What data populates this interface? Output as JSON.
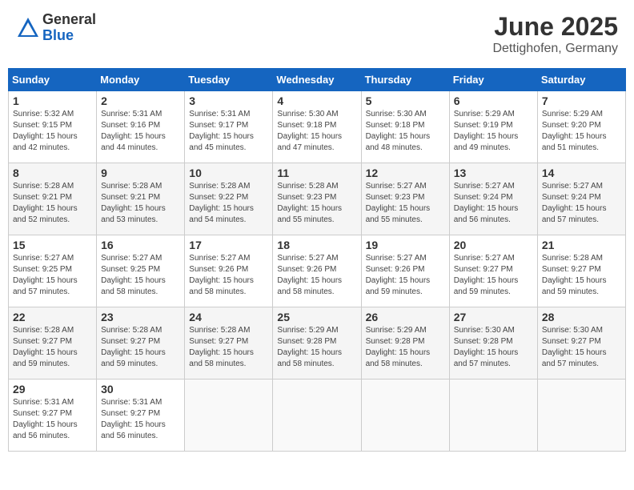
{
  "header": {
    "logo_general": "General",
    "logo_blue": "Blue",
    "month": "June 2025",
    "location": "Dettighofen, Germany"
  },
  "calendar": {
    "days_of_week": [
      "Sunday",
      "Monday",
      "Tuesday",
      "Wednesday",
      "Thursday",
      "Friday",
      "Saturday"
    ],
    "weeks": [
      [
        {
          "day": "",
          "info": ""
        },
        {
          "day": "2",
          "info": "Sunrise: 5:31 AM\nSunset: 9:16 PM\nDaylight: 15 hours\nand 44 minutes."
        },
        {
          "day": "3",
          "info": "Sunrise: 5:31 AM\nSunset: 9:17 PM\nDaylight: 15 hours\nand 45 minutes."
        },
        {
          "day": "4",
          "info": "Sunrise: 5:30 AM\nSunset: 9:18 PM\nDaylight: 15 hours\nand 47 minutes."
        },
        {
          "day": "5",
          "info": "Sunrise: 5:30 AM\nSunset: 9:18 PM\nDaylight: 15 hours\nand 48 minutes."
        },
        {
          "day": "6",
          "info": "Sunrise: 5:29 AM\nSunset: 9:19 PM\nDaylight: 15 hours\nand 49 minutes."
        },
        {
          "day": "7",
          "info": "Sunrise: 5:29 AM\nSunset: 9:20 PM\nDaylight: 15 hours\nand 51 minutes."
        }
      ],
      [
        {
          "day": "8",
          "info": "Sunrise: 5:28 AM\nSunset: 9:21 PM\nDaylight: 15 hours\nand 52 minutes."
        },
        {
          "day": "9",
          "info": "Sunrise: 5:28 AM\nSunset: 9:21 PM\nDaylight: 15 hours\nand 53 minutes."
        },
        {
          "day": "10",
          "info": "Sunrise: 5:28 AM\nSunset: 9:22 PM\nDaylight: 15 hours\nand 54 minutes."
        },
        {
          "day": "11",
          "info": "Sunrise: 5:28 AM\nSunset: 9:23 PM\nDaylight: 15 hours\nand 55 minutes."
        },
        {
          "day": "12",
          "info": "Sunrise: 5:27 AM\nSunset: 9:23 PM\nDaylight: 15 hours\nand 55 minutes."
        },
        {
          "day": "13",
          "info": "Sunrise: 5:27 AM\nSunset: 9:24 PM\nDaylight: 15 hours\nand 56 minutes."
        },
        {
          "day": "14",
          "info": "Sunrise: 5:27 AM\nSunset: 9:24 PM\nDaylight: 15 hours\nand 57 minutes."
        }
      ],
      [
        {
          "day": "15",
          "info": "Sunrise: 5:27 AM\nSunset: 9:25 PM\nDaylight: 15 hours\nand 57 minutes."
        },
        {
          "day": "16",
          "info": "Sunrise: 5:27 AM\nSunset: 9:25 PM\nDaylight: 15 hours\nand 58 minutes."
        },
        {
          "day": "17",
          "info": "Sunrise: 5:27 AM\nSunset: 9:26 PM\nDaylight: 15 hours\nand 58 minutes."
        },
        {
          "day": "18",
          "info": "Sunrise: 5:27 AM\nSunset: 9:26 PM\nDaylight: 15 hours\nand 58 minutes."
        },
        {
          "day": "19",
          "info": "Sunrise: 5:27 AM\nSunset: 9:26 PM\nDaylight: 15 hours\nand 59 minutes."
        },
        {
          "day": "20",
          "info": "Sunrise: 5:27 AM\nSunset: 9:27 PM\nDaylight: 15 hours\nand 59 minutes."
        },
        {
          "day": "21",
          "info": "Sunrise: 5:28 AM\nSunset: 9:27 PM\nDaylight: 15 hours\nand 59 minutes."
        }
      ],
      [
        {
          "day": "22",
          "info": "Sunrise: 5:28 AM\nSunset: 9:27 PM\nDaylight: 15 hours\nand 59 minutes."
        },
        {
          "day": "23",
          "info": "Sunrise: 5:28 AM\nSunset: 9:27 PM\nDaylight: 15 hours\nand 59 minutes."
        },
        {
          "day": "24",
          "info": "Sunrise: 5:28 AM\nSunset: 9:27 PM\nDaylight: 15 hours\nand 58 minutes."
        },
        {
          "day": "25",
          "info": "Sunrise: 5:29 AM\nSunset: 9:28 PM\nDaylight: 15 hours\nand 58 minutes."
        },
        {
          "day": "26",
          "info": "Sunrise: 5:29 AM\nSunset: 9:28 PM\nDaylight: 15 hours\nand 58 minutes."
        },
        {
          "day": "27",
          "info": "Sunrise: 5:30 AM\nSunset: 9:28 PM\nDaylight: 15 hours\nand 57 minutes."
        },
        {
          "day": "28",
          "info": "Sunrise: 5:30 AM\nSunset: 9:27 PM\nDaylight: 15 hours\nand 57 minutes."
        }
      ],
      [
        {
          "day": "29",
          "info": "Sunrise: 5:31 AM\nSunset: 9:27 PM\nDaylight: 15 hours\nand 56 minutes."
        },
        {
          "day": "30",
          "info": "Sunrise: 5:31 AM\nSunset: 9:27 PM\nDaylight: 15 hours\nand 56 minutes."
        },
        {
          "day": "",
          "info": ""
        },
        {
          "day": "",
          "info": ""
        },
        {
          "day": "",
          "info": ""
        },
        {
          "day": "",
          "info": ""
        },
        {
          "day": "",
          "info": ""
        }
      ]
    ],
    "week0_sunday": {
      "day": "1",
      "info": "Sunrise: 5:32 AM\nSunset: 9:15 PM\nDaylight: 15 hours\nand 42 minutes."
    }
  }
}
